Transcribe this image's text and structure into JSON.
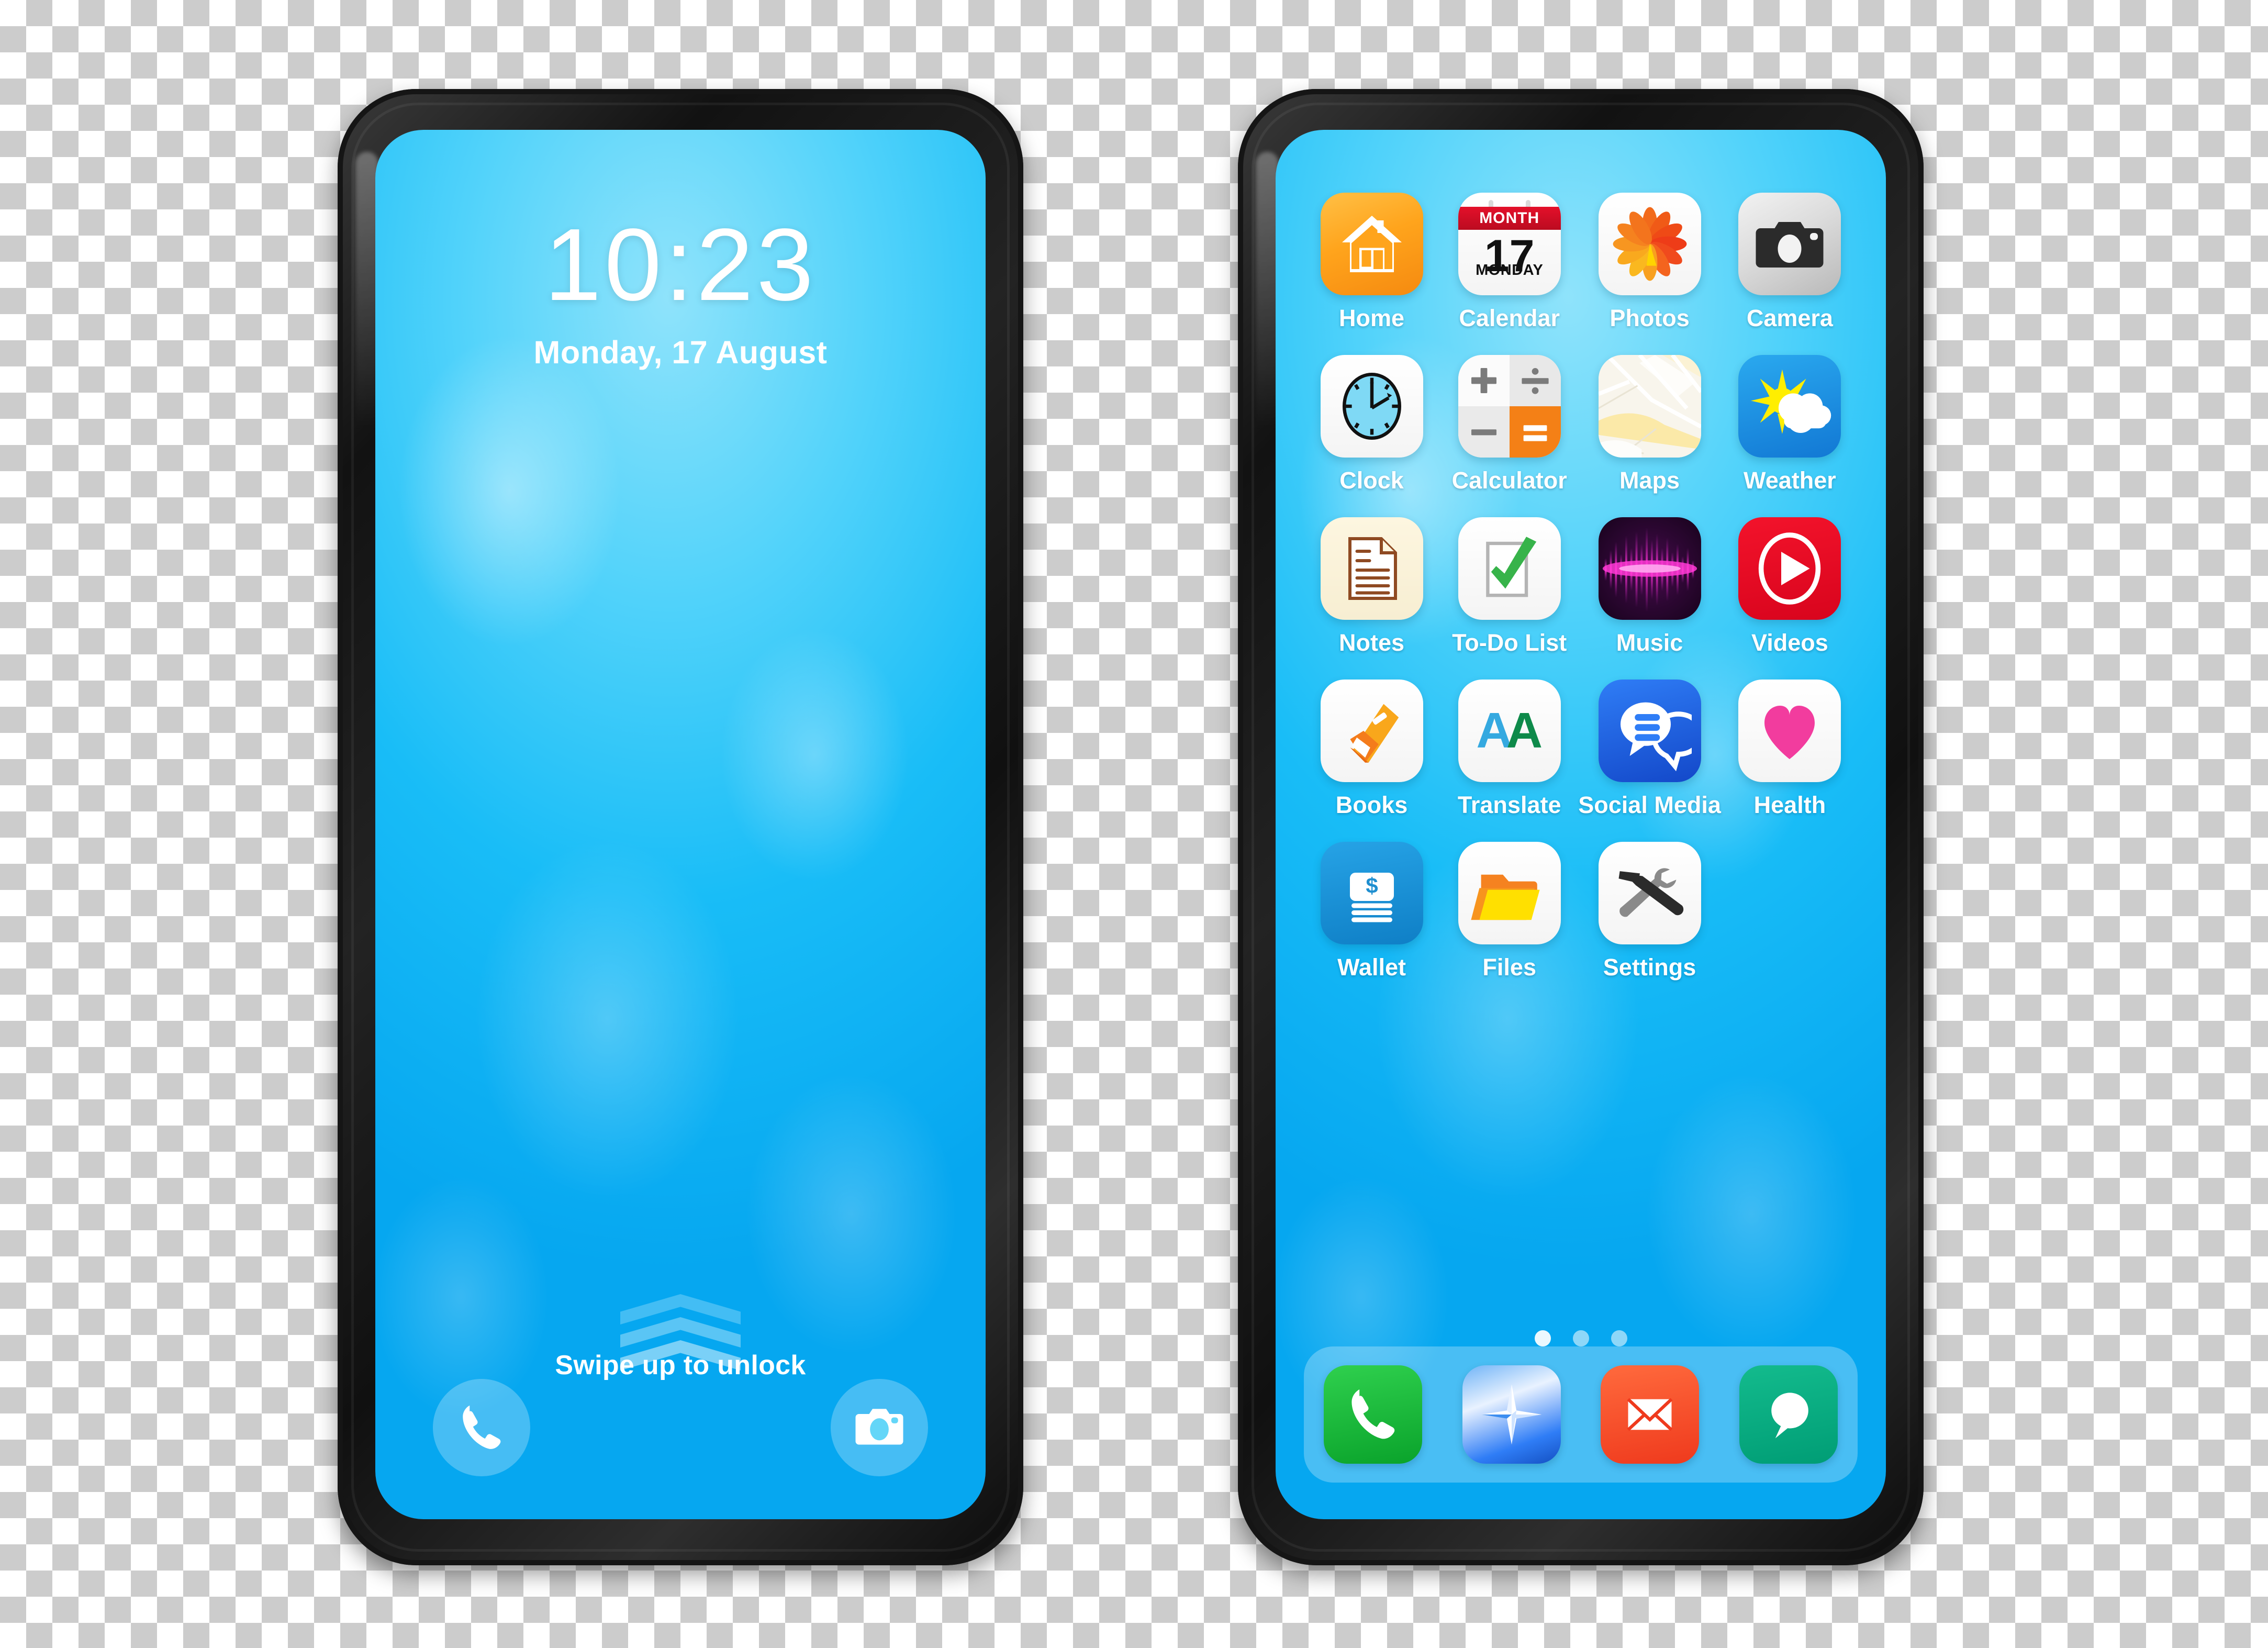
{
  "scene": {
    "description": "Two smartphone mockups on transparent checkerboard background",
    "background": "transparent-checkerboard",
    "checker_color": "#cccccc",
    "wallpaper_color": "#19bdf7"
  },
  "lock_screen": {
    "time": "10:23",
    "date": "Monday, 17 August",
    "swipe_hint": "Swipe up to unlock",
    "chevron_count": 3,
    "shortcuts": [
      {
        "name": "phone-shortcut",
        "icon": "phone-icon"
      },
      {
        "name": "camera-shortcut",
        "icon": "camera-icon"
      }
    ]
  },
  "home_screen": {
    "apps": [
      {
        "label": "Home",
        "icon": "house-icon"
      },
      {
        "label": "Calendar",
        "icon": "calendar-icon"
      },
      {
        "label": "Photos",
        "icon": "flower-icon"
      },
      {
        "label": "Camera",
        "icon": "camera-icon"
      },
      {
        "label": "Clock",
        "icon": "clock-icon"
      },
      {
        "label": "Calculator",
        "icon": "calculator-icon"
      },
      {
        "label": "Maps",
        "icon": "map-icon"
      },
      {
        "label": "Weather",
        "icon": "sun-cloud-icon"
      },
      {
        "label": "Notes",
        "icon": "document-icon"
      },
      {
        "label": "To-Do List",
        "icon": "checkbox-icon"
      },
      {
        "label": "Music",
        "icon": "waveform-icon"
      },
      {
        "label": "Videos",
        "icon": "play-icon"
      },
      {
        "label": "Books",
        "icon": "book-icon"
      },
      {
        "label": "Translate",
        "icon": "letter-a-icon"
      },
      {
        "label": "Social Media",
        "icon": "chat-bubbles-icon"
      },
      {
        "label": "Health",
        "icon": "heart-icon"
      },
      {
        "label": "Wallet",
        "icon": "money-stack-icon"
      },
      {
        "label": "Files",
        "icon": "folder-icon"
      },
      {
        "label": "Settings",
        "icon": "hammer-wrench-icon"
      }
    ],
    "calendar_icon": {
      "month": "MONTH",
      "day": "17",
      "weekday": "MONDAY"
    },
    "translate_icon": {
      "left_letter": "A",
      "right_letter": "A"
    },
    "wallet_icon": {
      "symbol": "$"
    },
    "page_dots": {
      "total": 3,
      "active_index": 0
    },
    "dock": [
      {
        "name": "phone-app",
        "icon": "phone-icon"
      },
      {
        "name": "browser-app",
        "icon": "compass-icon"
      },
      {
        "name": "mail-app",
        "icon": "envelope-icon"
      },
      {
        "name": "messages-app",
        "icon": "speech-bubble-icon"
      }
    ]
  },
  "colors": {
    "wallpaper": "#19bdf7",
    "home_orange": "#ffa41c",
    "calendar_red": "#e4102a",
    "videos_red": "#d8041d",
    "health_pink": "#f23c9e",
    "social_blue": "#1348c9",
    "wallet_blue": "#0f7fc6",
    "phone_green": "#0aa32b",
    "mail_red": "#ef3a1d",
    "messages_teal": "#009d75",
    "music_purple": "#2d0733",
    "weather_blue": "#1278d4",
    "bezel_black": "#121212"
  }
}
